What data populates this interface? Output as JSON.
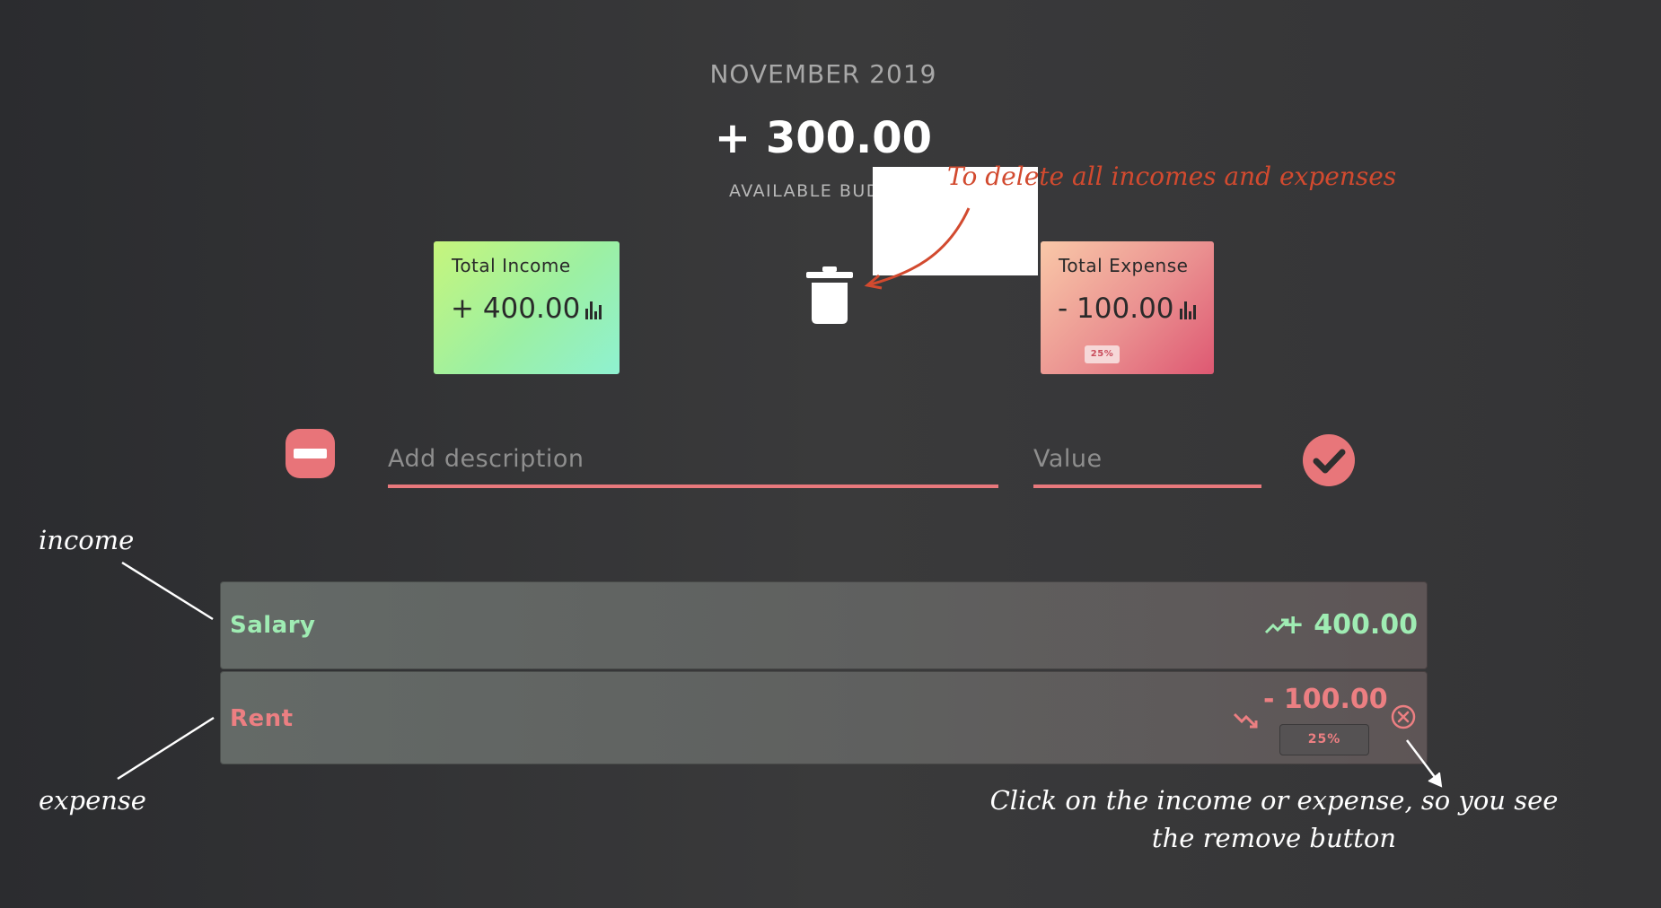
{
  "header": {
    "month": "NOVEMBER 2019",
    "budget": "+ 300.00",
    "budget_label": "AVAILABLE BUD"
  },
  "income_card": {
    "title": "Total Income",
    "value": "+ 400.00",
    "icon": "bar-chart-icon",
    "color": "#9cf0a3"
  },
  "expense_card": {
    "title": "Total Expense",
    "value": "- 100.00",
    "percentage": "25%",
    "icon": "bar-chart-icon",
    "color": "#ea9090"
  },
  "delete_all": {
    "icon": "trash-icon"
  },
  "form": {
    "type_toggle_icon": "minus-icon",
    "description_placeholder": "Add description",
    "value_placeholder": "Value",
    "submit_icon": "check-icon",
    "accent": "#e8787c"
  },
  "items": [
    {
      "type": "income",
      "description": "Salary",
      "amount": "+ 400.00",
      "icon": "trend-up-icon",
      "color": "#9fecb3"
    },
    {
      "type": "expense",
      "description": "Rent",
      "amount": "- 100.00",
      "percentage": "25%",
      "icon": "trend-down-icon",
      "remove_icon": "close-circle-icon",
      "color": "#ec7f82"
    }
  ],
  "annotations": {
    "delete_note": "To delete all incomes and expenses",
    "income_note": "income",
    "expense_note": "expense",
    "remove_note": "Click on the income or expense, so you see the remove button"
  }
}
